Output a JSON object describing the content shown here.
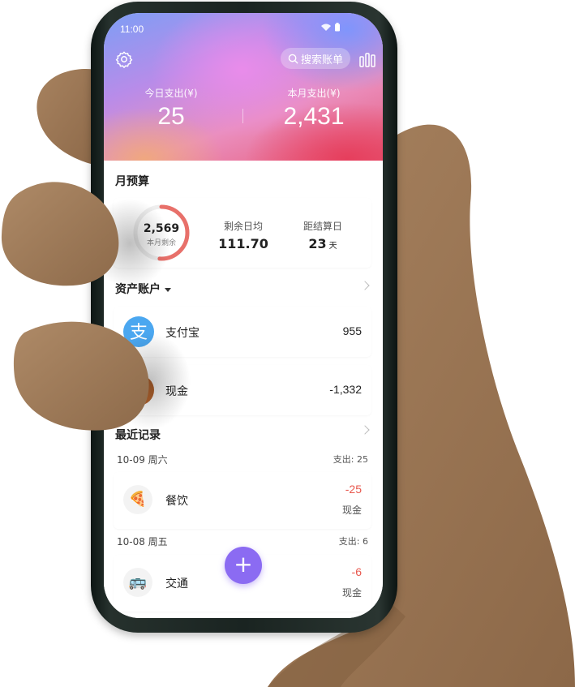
{
  "status_bar": {
    "time": "11:00"
  },
  "header": {
    "search_label": "搜索账单",
    "today_label": "今日支出(¥)",
    "today_value": "25",
    "month_label": "本月支出(¥)",
    "month_value": "2,431"
  },
  "budget": {
    "title": "月预算",
    "remaining_value": "2,569",
    "remaining_caption": "本月剩余",
    "remaining_fraction": 0.51,
    "daily_label": "剩余日均",
    "daily_value": "111.70",
    "settle_label": "距结算日",
    "settle_value": "23",
    "settle_unit": "天"
  },
  "assets": {
    "title": "资产账户",
    "accounts": [
      {
        "name": "支付宝",
        "amount": "955",
        "icon": "alipay-icon",
        "color": "#4ba7f0"
      },
      {
        "name": "现金",
        "amount": "-1,332",
        "icon": "cash-icon",
        "color": "#b5652f"
      }
    ]
  },
  "recent": {
    "title": "最近记录",
    "groups": [
      {
        "date": "10-09 周六",
        "summary": "支出: 25",
        "records": [
          {
            "category": "餐饮",
            "amount": "-25",
            "account": "现金",
            "icon": "pizza-icon"
          }
        ]
      },
      {
        "date": "10-08 周五",
        "summary": "支出: 6",
        "records": [
          {
            "category": "交通",
            "amount": "-6",
            "account": "现金",
            "icon": "bus-icon"
          }
        ]
      }
    ]
  },
  "fab": {
    "label": "+"
  },
  "colors": {
    "accent": "#8b6bf2",
    "expense": "#e8584e",
    "ring": "#e8706a"
  }
}
